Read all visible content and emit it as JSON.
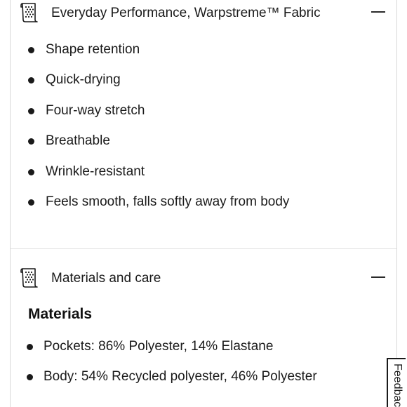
{
  "fabric_section": {
    "title": "Everyday Performance, Warpstreme™ Fabric",
    "icon": "fabric-swatch-icon",
    "toggle_icon": "minus-icon",
    "features": [
      "Shape retention",
      "Quick-drying",
      "Four-way stretch",
      "Breathable",
      "Wrinkle-resistant",
      "Feels smooth, falls softly away from body"
    ]
  },
  "materials_section": {
    "title": "Materials and care",
    "icon": "fabric-swatch-icon",
    "toggle_icon": "minus-icon",
    "heading": "Materials",
    "items": [
      "Pockets: 86% Polyester, 14% Elastane",
      "Body: 54% Recycled polyester, 46% Polyester"
    ]
  },
  "feedback_tab": {
    "label": "Feedback"
  }
}
